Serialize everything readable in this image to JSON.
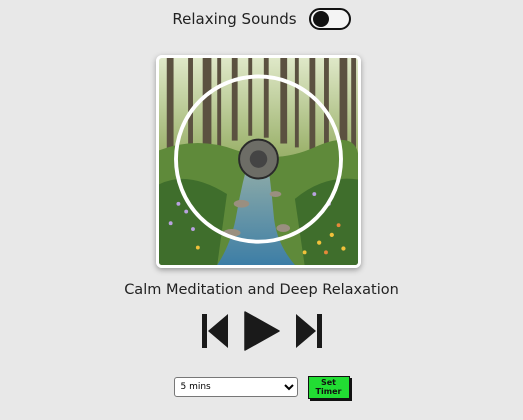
{
  "header": {
    "title": "Relaxing Sounds",
    "toggle_state": "off"
  },
  "player": {
    "track_title": "Calm Meditation and Deep Relaxation",
    "controls": {
      "previous_icon": "skip-previous-icon",
      "play_icon": "play-icon",
      "next_icon": "skip-next-icon"
    }
  },
  "timer": {
    "selected": "5 mins",
    "button_label": "Set Timer"
  },
  "colors": {
    "background": "#e8e8e8",
    "set_timer_button": "#22dd33"
  }
}
